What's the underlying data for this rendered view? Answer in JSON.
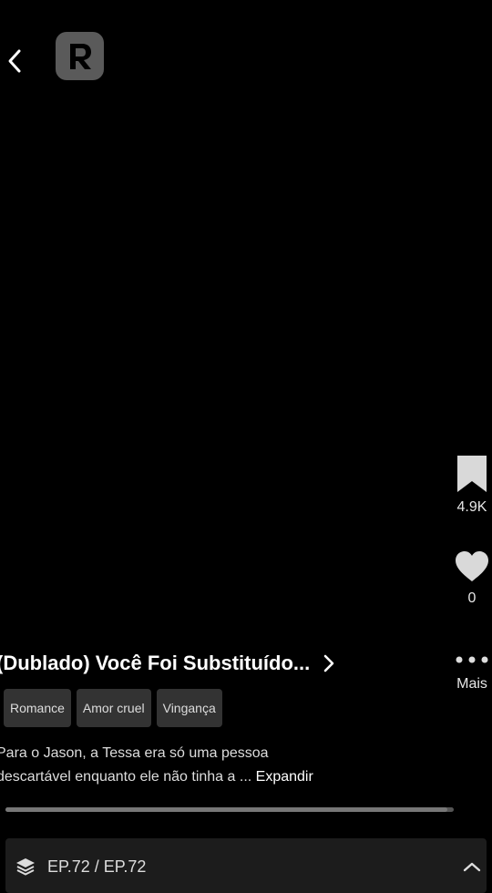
{
  "header": {
    "back_icon": "chevron-left-icon",
    "logo_icon": "app-logo-r-icon"
  },
  "actions": {
    "bookmark": {
      "icon": "bookmark-icon",
      "count": "4.9K"
    },
    "like": {
      "icon": "heart-icon",
      "count": "0"
    },
    "more": {
      "icon": "more-dots-icon",
      "label": "Mais"
    }
  },
  "series": {
    "title": "(Dublado) Você Foi Substituído...",
    "tags": [
      "Romance",
      "Amor cruel",
      "Vingança"
    ],
    "description_line1": "Para o Jason, a Tessa era só uma pessoa",
    "description_line2": "descartável enquanto ele não tinha a ... ",
    "expand_label": "Expandir"
  },
  "playback": {
    "progress": 0.985
  },
  "episode": {
    "label": "EP.72 / EP.72"
  }
}
